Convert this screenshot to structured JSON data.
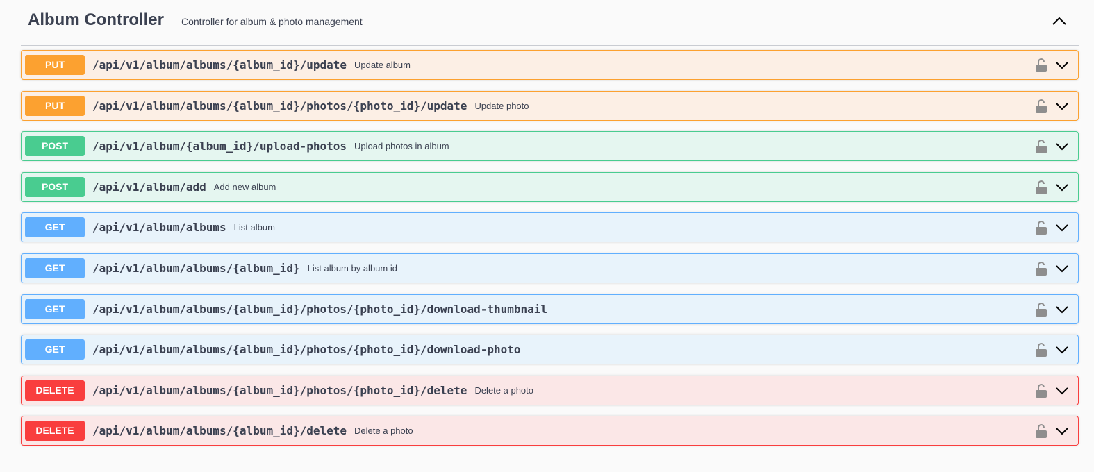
{
  "tag": {
    "title": "Album Controller",
    "description": "Controller for album & photo management",
    "collapse_icon": "chevron-up-icon"
  },
  "colors": {
    "put": "#fca130",
    "post": "#49cc90",
    "get": "#61affe",
    "delete": "#f93e3e"
  },
  "operations": [
    {
      "method": "PUT",
      "path": "/api/v1/album/albums/{album_id}/update",
      "summary": "Update album"
    },
    {
      "method": "PUT",
      "path": "/api/v1/album/albums/{album_id}/photos/{photo_id}/update",
      "summary": "Update photo"
    },
    {
      "method": "POST",
      "path": "/api/v1/album/{album_id}/upload-photos",
      "summary": "Upload photos in album"
    },
    {
      "method": "POST",
      "path": "/api/v1/album/add",
      "summary": "Add new album"
    },
    {
      "method": "GET",
      "path": "/api/v1/album/albums",
      "summary": "List album"
    },
    {
      "method": "GET",
      "path": "/api/v1/album/albums/{album_id}",
      "summary": "List album by album id"
    },
    {
      "method": "GET",
      "path": "/api/v1/album/albums/{album_id}/photos/{photo_id}/download-thumbnail",
      "summary": ""
    },
    {
      "method": "GET",
      "path": "/api/v1/album/albums/{album_id}/photos/{photo_id}/download-photo",
      "summary": ""
    },
    {
      "method": "DELETE",
      "path": "/api/v1/album/albums/{album_id}/photos/{photo_id}/delete",
      "summary": "Delete a photo"
    },
    {
      "method": "DELETE",
      "path": "/api/v1/album/albums/{album_id}/delete",
      "summary": "Delete a photo"
    }
  ]
}
